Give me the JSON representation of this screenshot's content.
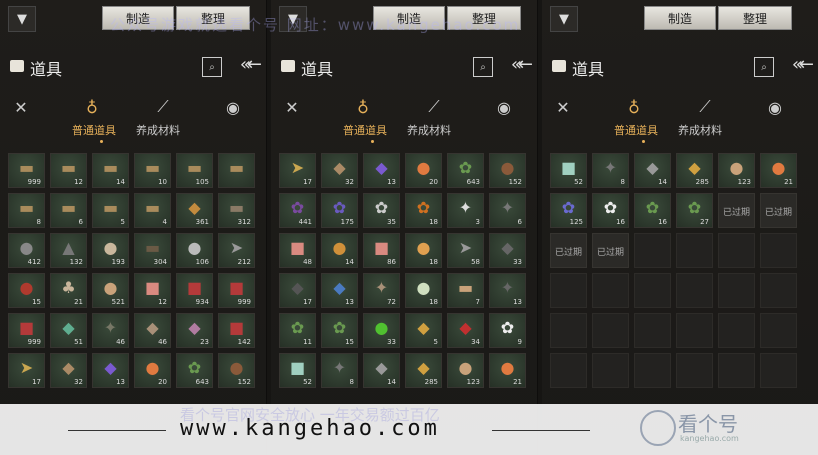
{
  "toolbar": {
    "make_label": "制造",
    "sort_label": "整理"
  },
  "panel": {
    "title": "道具",
    "tab_common": "普通道具",
    "tab_material": "养成材料"
  },
  "watermark": {
    "top": "公众号游戏就选看个号  网址：www.kangehao.com",
    "bottom": "看个号官网安全放心  一年交易额过百亿"
  },
  "banner": {
    "url": "www.kangehao.com",
    "logo": "看个号",
    "logo_sub": "kangehao.com"
  },
  "expired_label": "已过期",
  "panels": [
    {
      "cells": [
        {
          "g": "▬",
          "c": "#a98b5c",
          "n": "999"
        },
        {
          "g": "▬",
          "c": "#a98b5c",
          "n": "12"
        },
        {
          "g": "▬",
          "c": "#a98b5c",
          "n": "14"
        },
        {
          "g": "▬",
          "c": "#a98b5c",
          "n": "10"
        },
        {
          "g": "▬",
          "c": "#a98b5c",
          "n": "105"
        },
        {
          "g": "▬",
          "c": "#a98b5c",
          "n": ""
        },
        {
          "g": "▬",
          "c": "#a98b5c",
          "n": "8"
        },
        {
          "g": "▬",
          "c": "#a98b5c",
          "n": "6"
        },
        {
          "g": "▬",
          "c": "#a98b5c",
          "n": "5"
        },
        {
          "g": "▬",
          "c": "#a98b5c",
          "n": "4"
        },
        {
          "g": "◆",
          "c": "#c28b3e",
          "n": "361"
        },
        {
          "g": "▬",
          "c": "#8a7a66",
          "n": "312"
        },
        {
          "g": "●",
          "c": "#888",
          "n": "412"
        },
        {
          "g": "▲",
          "c": "#777",
          "n": "132"
        },
        {
          "g": "●",
          "c": "#c9b79c",
          "n": "193"
        },
        {
          "g": "▬",
          "c": "#6a5a45",
          "n": "304"
        },
        {
          "g": "●",
          "c": "#bbb",
          "n": "106"
        },
        {
          "g": "➤",
          "c": "#999",
          "n": "212"
        },
        {
          "g": "●",
          "c": "#b03a2e",
          "n": "15"
        },
        {
          "g": "♣",
          "c": "#c8b49a",
          "n": "21"
        },
        {
          "g": "●",
          "c": "#c9a27a",
          "n": "521"
        },
        {
          "g": "■",
          "c": "#d98a80",
          "n": "12"
        },
        {
          "g": "■",
          "c": "#b43a3a",
          "n": "934"
        },
        {
          "g": "■",
          "c": "#b43a3a",
          "n": "999"
        },
        {
          "g": "■",
          "c": "#b43a3a",
          "n": "999"
        },
        {
          "g": "◆",
          "c": "#5fae90",
          "n": "51"
        },
        {
          "g": "✦",
          "c": "#776",
          "n": "46"
        },
        {
          "g": "◆",
          "c": "#a89078",
          "n": "46"
        },
        {
          "g": "◆",
          "c": "#b07ca0",
          "n": "23"
        },
        {
          "g": "■",
          "c": "#b43a3a",
          "n": "142"
        },
        {
          "g": "➤",
          "c": "#c9a650",
          "n": "17"
        },
        {
          "g": "◆",
          "c": "#aa8a66",
          "n": "32"
        },
        {
          "g": "◆",
          "c": "#7a5ad0",
          "n": "13"
        },
        {
          "g": "●",
          "c": "#e07a40",
          "n": "20"
        },
        {
          "g": "✿",
          "c": "#6a9a50",
          "n": "643"
        },
        {
          "g": "●",
          "c": "#8a5a3a",
          "n": "152"
        }
      ]
    },
    {
      "cells": [
        {
          "g": "➤",
          "c": "#c9a650",
          "n": "17"
        },
        {
          "g": "◆",
          "c": "#aa8a66",
          "n": "32"
        },
        {
          "g": "◆",
          "c": "#7a5ad0",
          "n": "13"
        },
        {
          "g": "●",
          "c": "#e07a40",
          "n": "20"
        },
        {
          "g": "✿",
          "c": "#6a9a50",
          "n": "643"
        },
        {
          "g": "●",
          "c": "#8a5a3a",
          "n": "152"
        },
        {
          "g": "✿",
          "c": "#7a4aa0",
          "n": "441"
        },
        {
          "g": "✿",
          "c": "#6a5ac0",
          "n": "175"
        },
        {
          "g": "✿",
          "c": "#cccccc",
          "n": "35"
        },
        {
          "g": "✿",
          "c": "#d07020",
          "n": "18"
        },
        {
          "g": "✦",
          "c": "#ddd",
          "n": "3"
        },
        {
          "g": "✦",
          "c": "#777",
          "n": "6"
        },
        {
          "g": "■",
          "c": "#d98a80",
          "n": "48"
        },
        {
          "g": "●",
          "c": "#d0903a",
          "n": "14"
        },
        {
          "g": "■",
          "c": "#d98a80",
          "n": "86"
        },
        {
          "g": "●",
          "c": "#e0a050",
          "n": "18"
        },
        {
          "g": "➤",
          "c": "#999",
          "n": "58"
        },
        {
          "g": "◆",
          "c": "#666",
          "n": "33"
        },
        {
          "g": "◆",
          "c": "#555",
          "n": "17"
        },
        {
          "g": "◆",
          "c": "#4a7ac0",
          "n": "13"
        },
        {
          "g": "✦",
          "c": "#a89078",
          "n": "72"
        },
        {
          "g": "●",
          "c": "#d0e0c0",
          "n": "18"
        },
        {
          "g": "▬",
          "c": "#c9a27a",
          "n": "7"
        },
        {
          "g": "✦",
          "c": "#666",
          "n": "13"
        },
        {
          "g": "✿",
          "c": "#6a9a50",
          "n": "11"
        },
        {
          "g": "✿",
          "c": "#6a9a50",
          "n": "15"
        },
        {
          "g": "●",
          "c": "#50c030",
          "n": "33"
        },
        {
          "g": "◆",
          "c": "#d0a040",
          "n": "5"
        },
        {
          "g": "◆",
          "c": "#c03030",
          "n": "34"
        },
        {
          "g": "✿",
          "c": "#eeeeee",
          "n": "9"
        },
        {
          "g": "■",
          "c": "#a0d0c0",
          "n": "52"
        },
        {
          "g": "✦",
          "c": "#777",
          "n": "8"
        },
        {
          "g": "◆",
          "c": "#999",
          "n": "14"
        },
        {
          "g": "◆",
          "c": "#d0a040",
          "n": "285"
        },
        {
          "g": "●",
          "c": "#c9a27a",
          "n": "123"
        },
        {
          "g": "●",
          "c": "#e07a40",
          "n": "21"
        }
      ]
    },
    {
      "cells": [
        {
          "g": "■",
          "c": "#a0d0c0",
          "n": "52"
        },
        {
          "g": "✦",
          "c": "#777",
          "n": "8"
        },
        {
          "g": "◆",
          "c": "#999",
          "n": "14"
        },
        {
          "g": "◆",
          "c": "#d0a040",
          "n": "285"
        },
        {
          "g": "●",
          "c": "#c9a27a",
          "n": "123"
        },
        {
          "g": "●",
          "c": "#e07a40",
          "n": "21"
        },
        {
          "g": "✿",
          "c": "#6a6ad0",
          "n": "125"
        },
        {
          "g": "✿",
          "c": "#eeeeee",
          "n": "16"
        },
        {
          "g": "✿",
          "c": "#6a9a50",
          "n": "16"
        },
        {
          "g": "✿",
          "c": "#6a9a50",
          "n": "27"
        },
        {
          "g": "",
          "c": "",
          "n": "",
          "e": true
        },
        {
          "g": "",
          "c": "",
          "n": "",
          "e": true
        },
        {
          "g": "",
          "c": "",
          "n": "",
          "e": true
        },
        {
          "g": "",
          "c": "",
          "n": "",
          "e": true
        },
        {
          "g": "",
          "c": "",
          "n": "",
          "z": true
        },
        {
          "g": "",
          "c": "",
          "n": "",
          "z": true
        },
        {
          "g": "",
          "c": "",
          "n": "",
          "z": true
        },
        {
          "g": "",
          "c": "",
          "n": "",
          "z": true
        },
        {
          "z": true
        },
        {
          "z": true
        },
        {
          "z": true
        },
        {
          "z": true
        },
        {
          "z": true
        },
        {
          "z": true
        },
        {
          "z": true
        },
        {
          "z": true
        },
        {
          "z": true
        },
        {
          "z": true
        },
        {
          "z": true
        },
        {
          "z": true
        },
        {
          "z": true
        },
        {
          "z": true
        },
        {
          "z": true
        },
        {
          "z": true
        },
        {
          "z": true
        },
        {
          "z": true
        }
      ]
    }
  ]
}
